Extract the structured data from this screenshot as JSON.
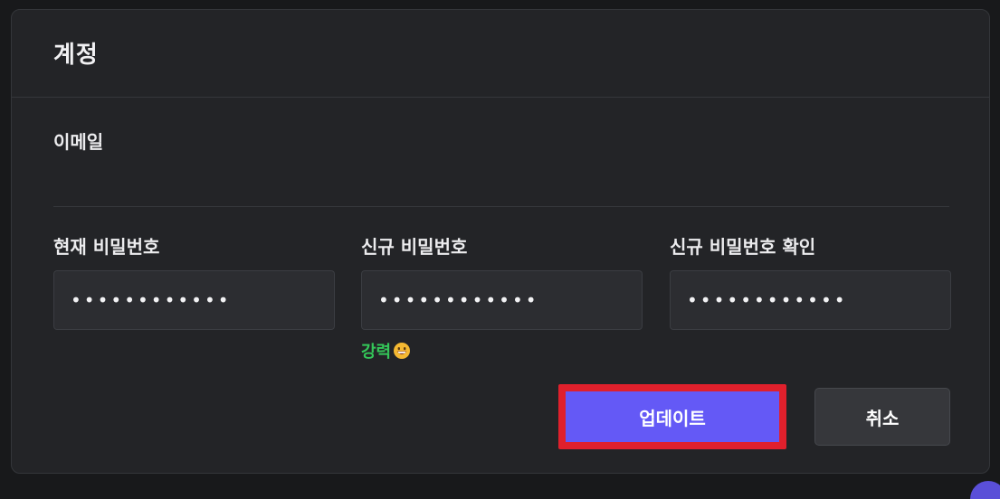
{
  "card": {
    "title": "계정"
  },
  "email": {
    "label": "이메일"
  },
  "fields": [
    {
      "label": "현재 비밀번호",
      "value": "••••••••••••"
    },
    {
      "label": "신규 비밀번호",
      "value": "••••••••••••"
    },
    {
      "label": "신규 비밀번호 확인",
      "value": "••••••••••••"
    }
  ],
  "strength": {
    "text": "강력",
    "color": "#34c759",
    "icon": "grinning-face-icon"
  },
  "actions": {
    "update_label": "업데이트",
    "cancel_label": "취소"
  },
  "colors": {
    "accent": "#6459f6",
    "highlight": "#e0202c",
    "background": "#232427"
  }
}
